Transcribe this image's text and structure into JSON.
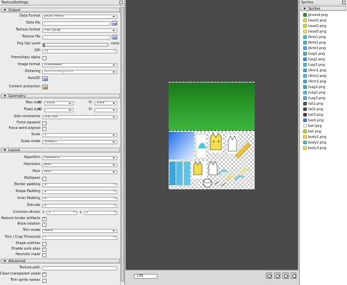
{
  "left_panel": {
    "title": "TextureSettings",
    "sections": {
      "output": "Output",
      "geometry": "Geometry",
      "layout": "Layout",
      "advanced": "Advanced"
    },
    "output": {
      "data_format": {
        "label": "Data Format",
        "value": "JSON (Hash)"
      },
      "data_file": {
        "label": "Data file",
        "value": ""
      },
      "texture_format": {
        "label": "Texture format",
        "value": "PNG (png)"
      },
      "texture_file": {
        "label": "Texture file",
        "value": ""
      },
      "png_opt_level": {
        "label": "Png Opt Level",
        "value": "none"
      },
      "dpi": {
        "label": "DPI",
        "value": "72"
      },
      "premultiply_alpha": {
        "label": "Premultiply alpha"
      },
      "image_format": {
        "label": "Image format",
        "value": "RGBA8888"
      },
      "dithering": {
        "label": "Dithering",
        "value": "NearestNeighbour"
      },
      "auto_sd": {
        "label": "AutoSD"
      },
      "content_protection": {
        "label": "Content protection"
      }
    },
    "geometry": {
      "max_size": {
        "label": "Max size",
        "w_label": "W:",
        "w": "1024",
        "h_label": "H:",
        "h": "1024"
      },
      "fixed_size": {
        "label": "Fixed size",
        "w_label": "W:",
        "w": "",
        "h_label": "H:",
        "h": ""
      },
      "size_constraints": {
        "label": "Size constraints",
        "value": "Any size"
      },
      "force_squared": {
        "label": "Force squared"
      },
      "force_word_aligned": {
        "label": "Force word aligned"
      },
      "scale": {
        "label": "Scale",
        "value": "1"
      },
      "scale_mode": {
        "label": "Scale mode",
        "value": "Smooth"
      }
    },
    "layout": {
      "algorithm": {
        "label": "Algorithm",
        "value": "MaxRects"
      },
      "heuristics": {
        "label": "Heuristics",
        "value": "Best"
      },
      "pack": {
        "label": "Pack",
        "value": "Best"
      },
      "multipack": {
        "label": "Multipack"
      },
      "border_padding": {
        "label": "Border padding",
        "value": "0"
      },
      "shape_padding": {
        "label": "Shape Padding",
        "value": "2"
      },
      "inner_padding": {
        "label": "Inner Padding",
        "value": "0"
      },
      "extrude": {
        "label": "Extrude",
        "value": "0"
      },
      "common_divisor": {
        "label": "Common divisor",
        "x_label": "x",
        "x": "1",
        "y_label": "y",
        "y": "1"
      },
      "reduce_border_artifacts": {
        "label": "Reduce border artifacts"
      },
      "allow_rotation": {
        "label": "Allow rotation"
      },
      "trim_mode": {
        "label": "Trim mode",
        "value": "None"
      },
      "trim_threshold": {
        "label": "Trim / Crop Threshold",
        "value": "1"
      },
      "shape_outlines": {
        "label": "Shape outlines"
      },
      "enable_auto_alias": {
        "label": "Enable auto alias"
      },
      "heuristic_mask": {
        "label": "Heuristic mask"
      }
    },
    "advanced": {
      "texture_path": {
        "label": "Texture path",
        "value": ""
      },
      "clean_transparent_pixels": {
        "label": "Clean transparent pixels"
      },
      "trim_sprite_names": {
        "label": "Trim sprite names"
      }
    }
  },
  "center": {
    "zoom_value": "136"
  },
  "right_panel": {
    "title": "Sprites",
    "section": "Sprites",
    "sprites": [
      {
        "name": "ground.png",
        "color": "#2a9a2a"
      },
      {
        "name": "head1.png",
        "color": "#f0e040"
      },
      {
        "name": "head2.png",
        "color": "#e8d830"
      },
      {
        "name": "head3.png",
        "color": "#f4e868"
      },
      {
        "name": "lArm1.png",
        "color": "#46c8e0"
      },
      {
        "name": "lArm2.png",
        "color": "#40c0d8"
      },
      {
        "name": "lArm3.png",
        "color": "#50b8e8"
      },
      {
        "name": "lLeg1.png",
        "color": "#4ab0e0"
      },
      {
        "name": "lLeg2.png",
        "color": "#2ea8d8"
      },
      {
        "name": "lLeg3.png",
        "color": "#58bce6"
      },
      {
        "name": "rArm1.png",
        "color": "#3cb4e4"
      },
      {
        "name": "rArm2.png",
        "color": "#5cc4ea"
      },
      {
        "name": "rArm3.png",
        "color": "#44b0dc"
      },
      {
        "name": "rLeg1.png",
        "color": "#3fa8d4"
      },
      {
        "name": "rLeg2.png",
        "color": "#62c0e6"
      },
      {
        "name": "rLeg3.png",
        "color": "#4cbae4"
      },
      {
        "name": "tail1.png",
        "color": "#555555"
      },
      {
        "name": "tail2.png",
        "color": "#505050"
      },
      {
        "name": "tail3.png",
        "color": "#4a4a4a"
      },
      {
        "name": "back.png",
        "color": "#3a86e6"
      },
      {
        "name": "ball.png",
        "color": "#ffffff"
      },
      {
        "name": "bat.png",
        "color": "#f2c028"
      },
      {
        "name": "body1.png",
        "color": "#f2e046"
      },
      {
        "name": "body2.png",
        "color": "#48c0e4"
      },
      {
        "name": "body3.png",
        "color": "#f0e060"
      }
    ]
  }
}
